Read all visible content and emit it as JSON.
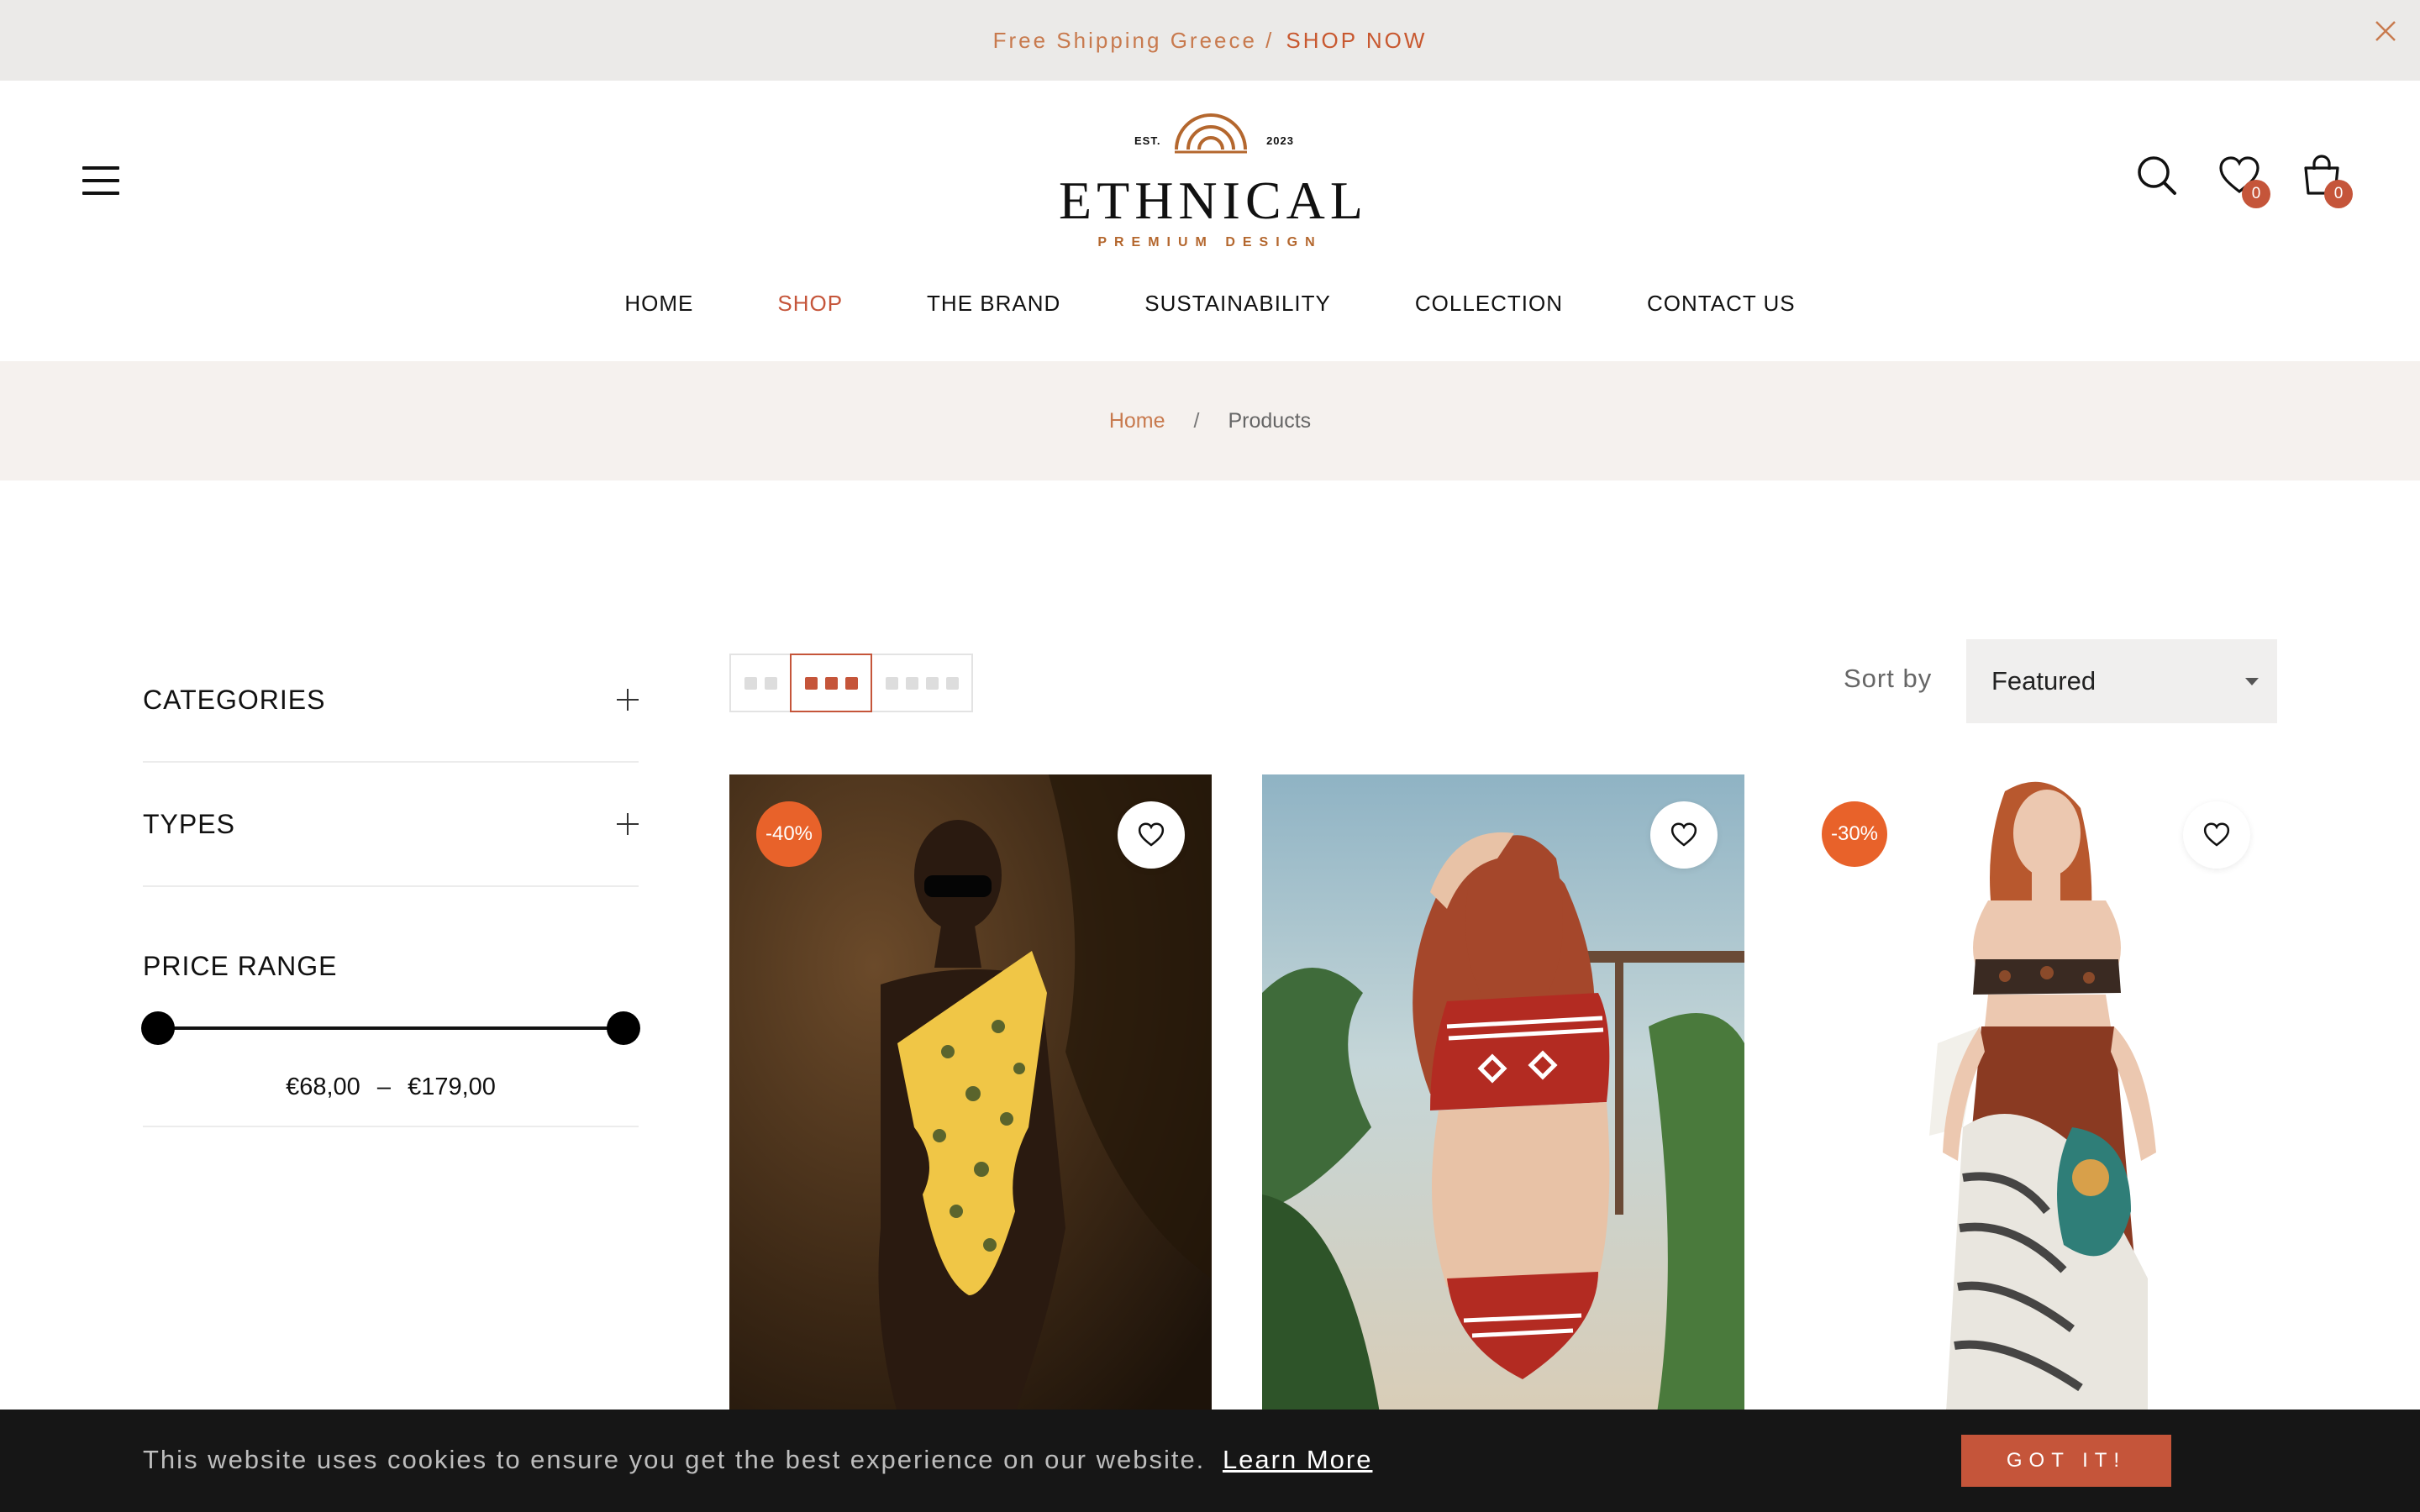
{
  "announcement": {
    "text": "Free Shipping Greece /",
    "link": "SHOP NOW"
  },
  "logo": {
    "est": "EST.",
    "year": "2023",
    "name": "ETHNICAL",
    "tagline": "PREMIUM DESIGN"
  },
  "header": {
    "wishlist_count": "0",
    "cart_count": "0",
    "icons": [
      "menu-icon",
      "search-icon",
      "heart-icon",
      "shopping-bag-icon"
    ]
  },
  "nav": [
    {
      "label": "HOME"
    },
    {
      "label": "SHOP"
    },
    {
      "label": "THE BRAND"
    },
    {
      "label": "SUSTAINABILITY"
    },
    {
      "label": "COLLECTION"
    },
    {
      "label": "CONTACT US"
    }
  ],
  "breadcrumb": {
    "home": "Home",
    "separator": "/",
    "current": "Products"
  },
  "sidebar": {
    "categories": "CATEGORIES",
    "types": "TYPES",
    "price_range": "PRICE RANGE",
    "price_min": "€68,00",
    "price_max": "€179,00",
    "price_dash": "–"
  },
  "toolbar": {
    "sort_label": "Sort by",
    "sort_value": "Featured",
    "active_layout": "3 columns"
  },
  "products": [
    {
      "discount": "-40%"
    },
    {
      "discount": ""
    },
    {
      "discount": "-30%"
    }
  ],
  "cookie": {
    "text": "This website uses cookies to ensure you get the best experience on our website.",
    "link": "Learn More",
    "button": "GOT IT!"
  },
  "colors": {
    "accent": "#c5553a",
    "discount": "#e8622a",
    "announce_bg": "#ebeae8",
    "breadcrumb_bg": "#f5f1ee",
    "cookie_bg": "#161616"
  }
}
